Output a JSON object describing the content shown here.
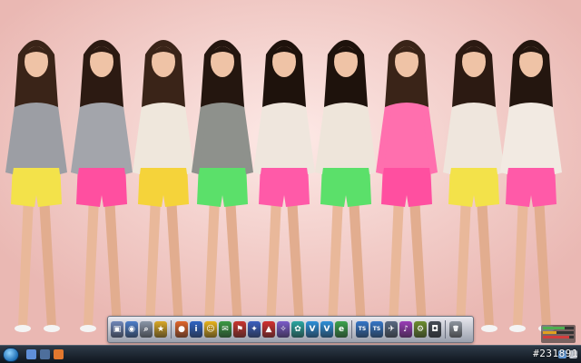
{
  "wallpaper": {
    "description_icon": "photo-wallpaper",
    "background_color": "#f4cfcc"
  },
  "dock": {
    "icons": [
      {
        "name": "finder-icon",
        "color": "#6f86b8",
        "glyph": "▣"
      },
      {
        "name": "globe-icon",
        "color": "#4c7dc9",
        "glyph": "◉"
      },
      {
        "name": "magnifier-icon",
        "color": "#8a96a8",
        "glyph": "⌕"
      },
      {
        "name": "star-icon",
        "color": "#d9a826",
        "glyph": "★"
      },
      {
        "name": "firefox-icon",
        "color": "#e0652b",
        "glyph": "●"
      },
      {
        "name": "info-icon",
        "color": "#2f63c4",
        "glyph": "i"
      },
      {
        "name": "smiley-icon",
        "color": "#e8b31c",
        "glyph": "☺"
      },
      {
        "name": "chat-icon",
        "color": "#3b9a44",
        "glyph": "✉"
      },
      {
        "name": "flag-icon",
        "color": "#c8342f",
        "glyph": "⚑"
      },
      {
        "name": "maps-icon",
        "color": "#3b5fbf",
        "glyph": "✦"
      },
      {
        "name": "triangle-icon",
        "color": "#d22f2f",
        "glyph": "▲"
      },
      {
        "name": "wing-icon",
        "color": "#7b5bc9",
        "glyph": "✧"
      },
      {
        "name": "paint-icon",
        "color": "#2aa6a1",
        "glyph": "✿"
      },
      {
        "name": "v-icon-1",
        "color": "#2d8fd9",
        "glyph": "V"
      },
      {
        "name": "v-icon-2",
        "color": "#2d8fd9",
        "glyph": "V"
      },
      {
        "name": "e-icon",
        "color": "#3da34d",
        "glyph": "e"
      },
      {
        "name": "ts-icon-1",
        "color": "#3576c8",
        "glyph": "TS"
      },
      {
        "name": "ts-icon-2",
        "color": "#3576c8",
        "glyph": "TS"
      },
      {
        "name": "bird-icon",
        "color": "#5a6a82",
        "glyph": "✈"
      },
      {
        "name": "music-icon",
        "color": "#9a3bb8",
        "glyph": "♪"
      },
      {
        "name": "tools-icon",
        "color": "#6c8d2f",
        "glyph": "⚙"
      },
      {
        "name": "camera-icon",
        "color": "#444a55",
        "glyph": "◘"
      },
      {
        "name": "trash-icon",
        "color": "#8d949e",
        "glyph": "🗑"
      }
    ]
  },
  "taskbar": {
    "quick_launch": [
      {
        "name": "show-desktop-icon",
        "color": "#5f8fd8"
      },
      {
        "name": "window-switch-icon",
        "color": "#4e6f9c"
      },
      {
        "name": "media-player-icon",
        "color": "#e3782e"
      }
    ],
    "tray": [
      {
        "name": "network-icon",
        "color": "#6aa6e8"
      },
      {
        "name": "volume-icon",
        "color": "#cfd6df"
      }
    ]
  },
  "meter": {
    "rows": [
      {
        "level": 0.7,
        "color": "#4caf50"
      },
      {
        "level": 0.45,
        "color": "#e0a020"
      },
      {
        "level": 0.85,
        "color": "#d23c3c"
      }
    ]
  },
  "watermark": {
    "text": "#231891"
  }
}
